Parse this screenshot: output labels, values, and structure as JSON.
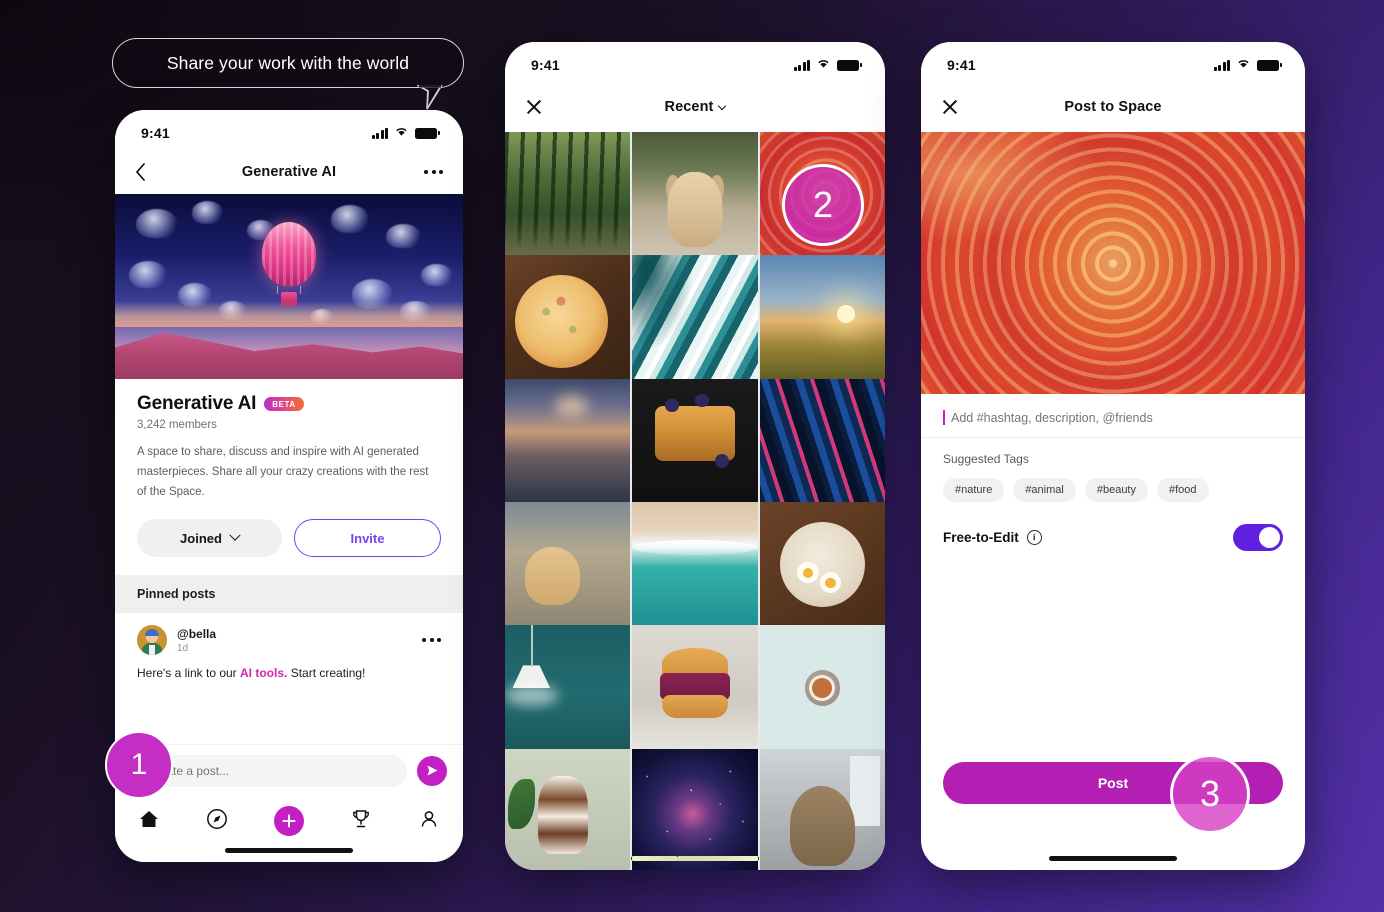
{
  "callout": {
    "text": "Share your work with the world"
  },
  "steps": [
    {
      "id": "1",
      "label": "1"
    },
    {
      "id": "2",
      "label": "2"
    },
    {
      "id": "3",
      "label": "3"
    }
  ],
  "phone1": {
    "status": {
      "time": "9:41",
      "signal_icon": "cellular-bars-icon",
      "wifi_icon": "wifi-icon",
      "battery_icon": "battery-icon"
    },
    "nav": {
      "back_icon": "chevron-left-icon",
      "title": "Generative AI",
      "more_icon": "more-options-icon"
    },
    "hero": {
      "alt": "hot-air-balloon-jellyfish-artwork"
    },
    "space": {
      "title": "Generative AI",
      "badge": "BETA",
      "members": "3,242 members",
      "description": "A space to share, discuss and inspire with AI generated masterpieces. Share all your crazy creations with the rest of the Space.",
      "joined_label": "Joined",
      "invite_label": "Invite"
    },
    "pinned_header": "Pinned posts",
    "post": {
      "user": "@bella",
      "time": "1d",
      "text_before": "Here's a link to our ",
      "link": "AI tools.",
      "text_after": " Start creating!",
      "more_icon": "more-options-icon"
    },
    "composer": {
      "placeholder": "Create a post...",
      "send_icon": "send-icon"
    },
    "tabs": [
      {
        "name": "home",
        "icon": "home-icon",
        "active": true
      },
      {
        "name": "explore",
        "icon": "compass-icon",
        "active": false
      },
      {
        "name": "create",
        "icon": "plus-icon",
        "active": false
      },
      {
        "name": "challenges",
        "icon": "trophy-icon",
        "active": false
      },
      {
        "name": "profile",
        "icon": "person-icon",
        "active": false
      }
    ]
  },
  "phone2": {
    "status": {
      "time": "9:41",
      "signal_icon": "cellular-bars-icon",
      "wifi_icon": "wifi-icon",
      "battery_icon": "battery-icon"
    },
    "nav": {
      "close_icon": "close-icon",
      "title": "Recent",
      "chevron_icon": "chevron-down-icon"
    },
    "grid": [
      {
        "alt": "forest-path",
        "art": "art-forest"
      },
      {
        "alt": "golden-puppy",
        "art": "art-puppy"
      },
      {
        "alt": "orange-abstract",
        "art": "art-orange",
        "selected": true
      },
      {
        "alt": "pizza-on-board",
        "art": "art-pizza"
      },
      {
        "alt": "teal-marble-art",
        "art": "art-marble-teal"
      },
      {
        "alt": "sunset-field",
        "art": "art-field"
      },
      {
        "alt": "lake-at-sunrise",
        "art": "art-lake"
      },
      {
        "alt": "french-toast",
        "art": "art-toast"
      },
      {
        "alt": "blue-marble-art",
        "art": "art-marble-blue"
      },
      {
        "alt": "golden-retriever",
        "art": "art-dog2"
      },
      {
        "alt": "ocean-shoreline",
        "art": "art-beach"
      },
      {
        "alt": "ramen-bowl",
        "art": "art-bowl"
      },
      {
        "alt": "pendant-lamp",
        "art": "art-lamp"
      },
      {
        "alt": "pulled-pork-burger",
        "art": "art-burger"
      },
      {
        "alt": "cup-of-coffee",
        "art": "art-coffee"
      },
      {
        "alt": "dessert-parfait",
        "art": "art-dessert"
      },
      {
        "alt": "galaxy-nebula",
        "art": "art-galaxy"
      },
      {
        "alt": "dog-by-window",
        "art": "art-dog3"
      }
    ]
  },
  "phone3": {
    "status": {
      "time": "9:41",
      "signal_icon": "cellular-bars-icon",
      "wifi_icon": "wifi-icon",
      "battery_icon": "battery-icon"
    },
    "nav": {
      "close_icon": "close-icon",
      "title": "Post to Space"
    },
    "hero": {
      "alt": "orange-paper-spiral-artwork"
    },
    "caption": {
      "value": "",
      "placeholder": "Add #hashtag, description, @friends"
    },
    "suggested_label": "Suggested Tags",
    "tags": [
      "#nature",
      "#animal",
      "#beauty",
      "#food"
    ],
    "free_to_edit": {
      "label": "Free-to-Edit",
      "info_icon": "info-icon",
      "enabled": true
    },
    "post_label": "Post"
  },
  "colors": {
    "accent_magenta": "#c41fc4",
    "accent_purple": "#7b3ff2",
    "toggle_on": "#6020e0",
    "link": "#d426a8"
  }
}
